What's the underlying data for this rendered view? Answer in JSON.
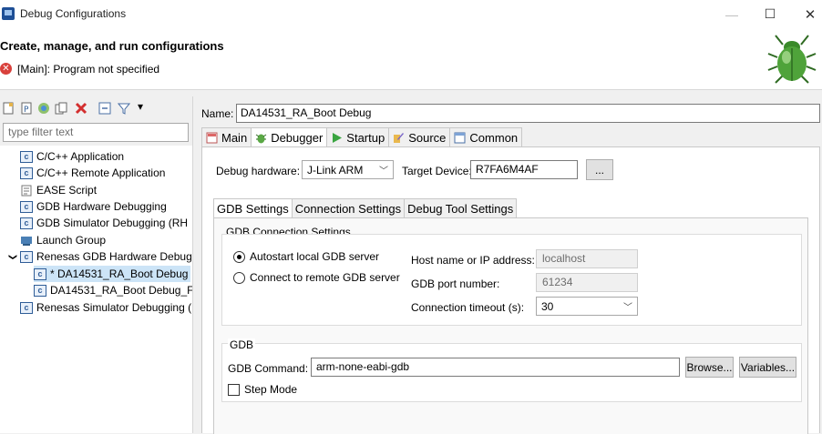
{
  "window": {
    "title": "Debug Configurations",
    "minimize_glyph": "—",
    "maximize_glyph": "☐",
    "close_glyph": "✕"
  },
  "header": {
    "title": "Create, manage, and run configurations",
    "error_message": "[Main]: Program not specified",
    "error_icon_glyph": "✕"
  },
  "sidebar": {
    "filter_placeholder": "type filter text",
    "toolbar_menu_glyph": "▾",
    "items": [
      {
        "label": "C/C++ Application",
        "icon": "c-icon"
      },
      {
        "label": "C/C++ Remote Application",
        "icon": "c-icon"
      },
      {
        "label": "EASE Script",
        "icon": "script-icon"
      },
      {
        "label": "GDB Hardware Debugging",
        "icon": "c-icon"
      },
      {
        "label": "GDB Simulator Debugging (RH",
        "icon": "c-icon"
      },
      {
        "label": "Launch Group",
        "icon": "launch-group-icon"
      },
      {
        "label": "Renesas GDB Hardware Debugg",
        "icon": "c-icon",
        "expanded": true
      },
      {
        "label": "* DA14531_RA_Boot Debug",
        "icon": "c-icon",
        "selected": true
      },
      {
        "label": "DA14531_RA_Boot Debug_F",
        "icon": "c-icon"
      },
      {
        "label": "Renesas Simulator Debugging (",
        "icon": "c-icon"
      }
    ],
    "expand_glyph": "❯"
  },
  "config": {
    "name_label": "Name:",
    "name_value": "DA14531_RA_Boot Debug",
    "tabs": [
      "Main",
      "Debugger",
      "Startup",
      "Source",
      "Common"
    ],
    "active_tab": "Debugger",
    "debug_hardware_label": "Debug hardware:",
    "debug_hardware_value": "J-Link ARM",
    "target_device_label": "Target Device:",
    "target_device_value": "R7FA6M4AF",
    "browse_device_label": "...",
    "inner_tabs": [
      "GDB Settings",
      "Connection Settings",
      "Debug Tool Settings"
    ],
    "gdb_connection": {
      "group_label": "GDB Connection Settings",
      "autostart_label": "Autostart local GDB server",
      "remote_label": "Connect to remote GDB server",
      "host_label": "Host name or IP address:",
      "host_value": "localhost",
      "port_label": "GDB port number:",
      "port_value": "61234",
      "timeout_label": "Connection timeout (s):",
      "timeout_value": "30"
    },
    "gdb": {
      "group_label": "GDB",
      "command_label": "GDB Command:",
      "command_value": "arm-none-eabi-gdb",
      "browse_label": "Browse...",
      "variables_label": "Variables...",
      "step_mode_label": "Step Mode"
    }
  },
  "colors": {
    "selection": "#cce4f7",
    "error": "#d9413c",
    "bug_green": "#4fa33a"
  }
}
